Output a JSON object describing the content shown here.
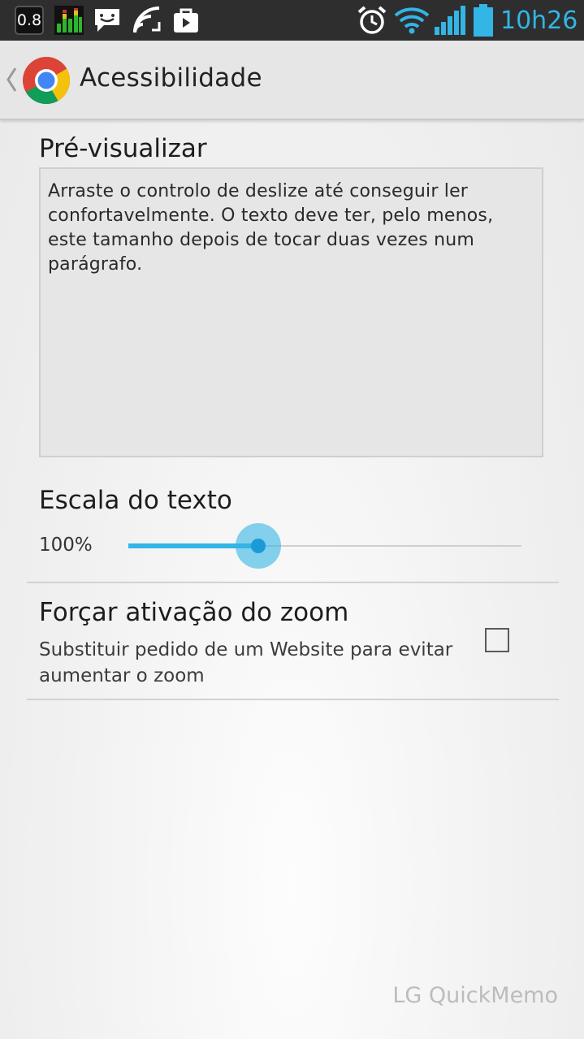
{
  "status_bar": {
    "speed_badge": "0.8",
    "time": "10h26",
    "icons": [
      "speed-badge-icon",
      "equalizer-icon",
      "chat-notification-icon",
      "cast-icon",
      "bag-icon",
      "alarm-icon",
      "wifi-icon",
      "signal-icon",
      "battery-icon"
    ],
    "accent": "#33b5e5"
  },
  "app_bar": {
    "title": "Acessibilidade",
    "icon": "chrome-icon",
    "back_icon": "chevron-left-icon"
  },
  "preview": {
    "heading": "Pré-visualizar",
    "text": "Arraste o controlo de deslize até conseguir ler confortavelmente. O texto deve ter, pelo menos, este tamanho depois de tocar duas vezes num parágrafo."
  },
  "text_scale": {
    "heading": "Escala do texto",
    "value_label": "100%",
    "slider_fraction": 0.33,
    "accent": "#33b5e5"
  },
  "force_zoom": {
    "title": "Forçar ativação do zoom",
    "description": "Substituir pedido de um Website para evitar aumentar o zoom",
    "checked": false
  },
  "watermark": "LG QuickMemo"
}
